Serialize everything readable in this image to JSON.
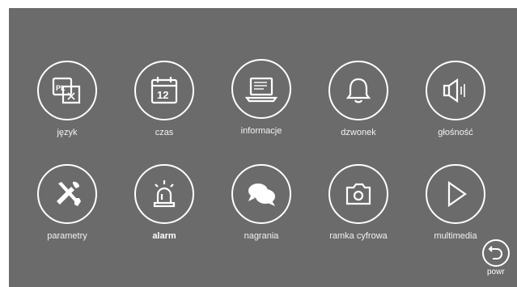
{
  "menu": {
    "items": [
      {
        "label": "język"
      },
      {
        "label": "czas",
        "calendar_day": "12"
      },
      {
        "label": "informacje"
      },
      {
        "label": "dzwonek"
      },
      {
        "label": "głośność"
      },
      {
        "label": "parametry"
      },
      {
        "label": "alarm"
      },
      {
        "label": "nagrania"
      },
      {
        "label": "ramka cyfrowa"
      },
      {
        "label": "multimedia"
      }
    ],
    "language_icon_text": "PL",
    "back_label": "powr"
  },
  "icons": [
    "language-icon",
    "calendar-icon",
    "laptop-icon",
    "bell-icon",
    "speaker-icon",
    "tools-icon",
    "siren-icon",
    "speech-bubbles-icon",
    "camera-icon",
    "play-icon",
    "back-arrow-icon"
  ],
  "colors": {
    "panel": "#6b6b6b",
    "foreground": "#ffffff"
  }
}
